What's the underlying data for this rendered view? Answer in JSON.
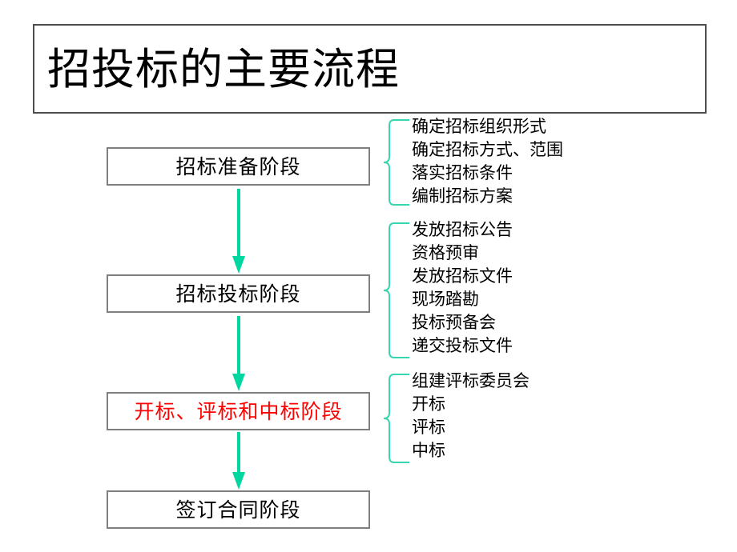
{
  "slide": {
    "title": "招投标的主要流程",
    "background_color": "#ffffff",
    "accent_color": "#00D6A0",
    "highlight_color": "#ff0000",
    "box_border_color": "#7f7f7f",
    "title_border_color": "#4d4d4d"
  },
  "flow": {
    "stages": [
      {
        "label": "招标准备阶段",
        "highlighted": false,
        "details": [
          "确定招标组织形式",
          "确定招标方式、范围",
          "落实招标条件",
          "编制招标方案"
        ]
      },
      {
        "label": "招标投标阶段",
        "highlighted": false,
        "details": [
          "发放招标公告",
          "资格预审",
          "发放招标文件",
          "现场踏勘",
          "投标预备会",
          "递交投标文件"
        ]
      },
      {
        "label": "开标、评标和中标阶段",
        "highlighted": true,
        "details": [
          "组建评标委员会",
          "开标",
          "评标",
          "中标"
        ]
      },
      {
        "label": "签订合同阶段",
        "highlighted": false,
        "details": []
      }
    ],
    "connector_icon": "down-arrow-icon",
    "brace_icon": "curly-brace-icon"
  }
}
